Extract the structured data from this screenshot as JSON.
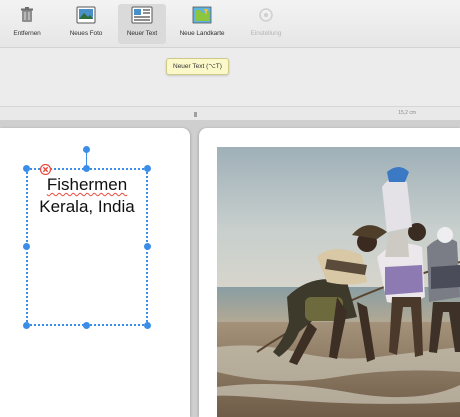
{
  "toolbar": {
    "items": [
      {
        "label": "Entfernen",
        "icon": "trash-icon"
      },
      {
        "label": "Neues Foto",
        "icon": "photo-icon"
      },
      {
        "label": "Neuer Text",
        "icon": "text-icon",
        "active": true
      },
      {
        "label": "Neue Landkarte",
        "icon": "map-icon"
      },
      {
        "label": "Einstellung",
        "icon": "settings-icon",
        "disabled": true
      }
    ]
  },
  "tooltip": {
    "text": "Neuer Text (⌥T)"
  },
  "ruler": {
    "measurement": "15,2 cm"
  },
  "textbox": {
    "line1": "Fishermen",
    "line2": "Kerala, India"
  },
  "colors": {
    "selection": "#3b8ee8",
    "close": "#e74c3c",
    "tooltip_bg": "#fbf8c9"
  }
}
